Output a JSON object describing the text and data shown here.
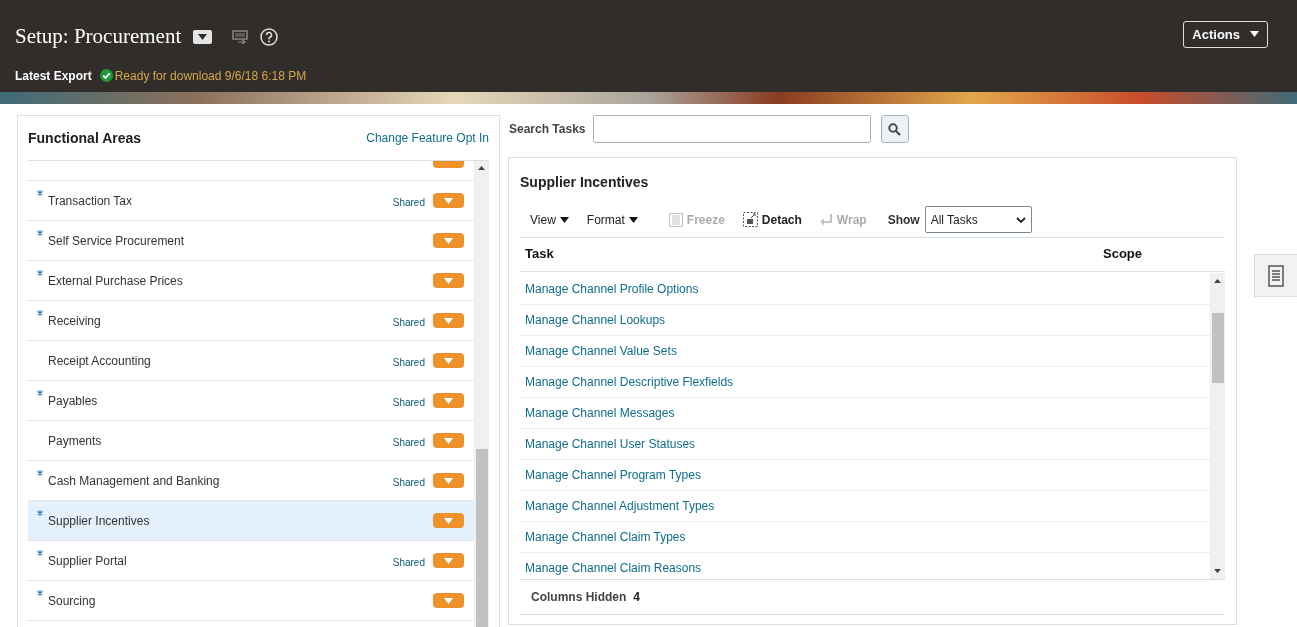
{
  "header": {
    "title": "Setup: Procurement",
    "actions_label": "Actions",
    "export_label": "Latest Export",
    "export_status": "Ready for download 9/6/18 6:18 PM"
  },
  "functional_areas": {
    "title": "Functional Areas",
    "link": "Change Feature Opt In",
    "items": [
      {
        "label": "Transaction Tax",
        "required": true,
        "shared_label": "Shared",
        "selected": false
      },
      {
        "label": "Self Service Procurement",
        "required": true,
        "selected": false
      },
      {
        "label": "External Purchase Prices",
        "required": true,
        "selected": false
      },
      {
        "label": "Receiving",
        "required": true,
        "shared_label": "Shared",
        "selected": false
      },
      {
        "label": "Receipt Accounting",
        "required": false,
        "shared_label": "Shared",
        "selected": false
      },
      {
        "label": "Payables",
        "required": true,
        "shared_label": "Shared",
        "selected": false
      },
      {
        "label": "Payments",
        "required": false,
        "shared_label": "Shared",
        "selected": false
      },
      {
        "label": "Cash Management and Banking",
        "required": true,
        "shared_label": "Shared",
        "selected": false
      },
      {
        "label": "Supplier Incentives",
        "required": true,
        "selected": true
      },
      {
        "label": "Supplier Portal",
        "required": true,
        "shared_label": "Shared",
        "selected": false
      },
      {
        "label": "Sourcing",
        "required": true,
        "selected": false
      }
    ]
  },
  "search": {
    "label": "Search Tasks"
  },
  "tasks_panel": {
    "title": "Supplier Incentives",
    "toolbar": [
      {
        "label": "View",
        "kind": "menu",
        "disabled": false
      },
      {
        "label": "Format",
        "kind": "menu",
        "disabled": false
      },
      {
        "label": "Freeze",
        "kind": "freeze",
        "disabled": true
      },
      {
        "label": "Detach",
        "kind": "detach",
        "disabled": false
      },
      {
        "label": "Wrap",
        "kind": "wrap",
        "disabled": true
      }
    ],
    "show_label": "Show",
    "show_value": "All Tasks",
    "columns": [
      "Task",
      "Scope"
    ],
    "rows": [
      "Manage Channel Profile Options",
      "Manage Channel Lookups",
      "Manage Channel Value Sets",
      "Manage Channel Descriptive Flexfields",
      "Manage Channel Messages",
      "Manage Channel User Statuses",
      "Manage Channel Program Types",
      "Manage Channel Adjustment Types",
      "Manage Channel Claim Types",
      "Manage Channel Claim Reasons"
    ],
    "footer_label": "Columns Hidden",
    "footer_count": "4"
  }
}
